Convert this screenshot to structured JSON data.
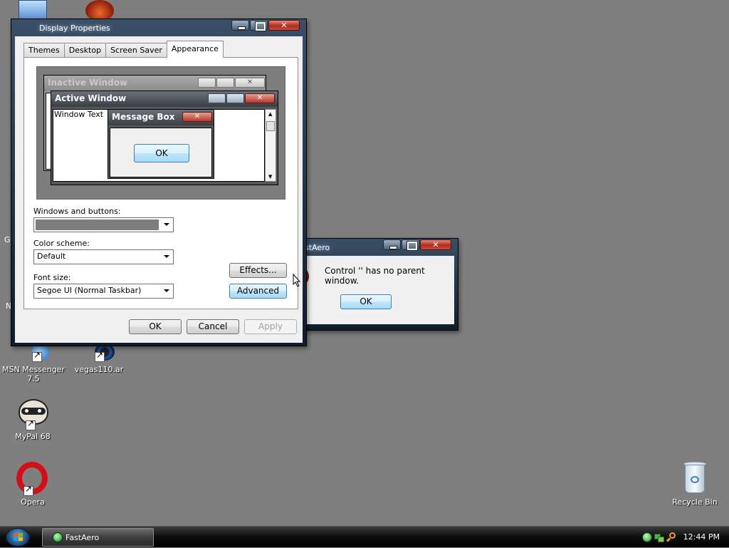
{
  "desktop": {
    "icons": [
      {
        "label": "MSN Messenger\n7.5",
        "icon": "msn-messenger-icon"
      },
      {
        "label": "vegas110.ar",
        "icon": "vegas-icon"
      },
      {
        "label": "MyPal 68",
        "icon": "mypal-raccoon-icon"
      },
      {
        "label": "Opera",
        "icon": "opera-icon"
      },
      {
        "label": "Recycle Bin",
        "icon": "recycle-bin-icon"
      }
    ],
    "edge_letters": [
      "G",
      "N"
    ]
  },
  "display_properties": {
    "title": "Display Properties",
    "tabs": [
      "Themes",
      "Desktop",
      "Screen Saver",
      "Appearance"
    ],
    "active_tab": "Appearance",
    "preview": {
      "inactive_title": "Inactive Window",
      "active_title": "Active Window",
      "window_text": "Window Text",
      "message_box_title": "Message Box",
      "ok_label": "OK"
    },
    "windows_and_buttons_label": "Windows and buttons:",
    "windows_and_buttons_value": "",
    "color_scheme_label": "Color scheme:",
    "color_scheme_value": "Default",
    "font_size_label": "Font size:",
    "font_size_value": "Segoe UI (Normal Taskbar)",
    "effects_label": "Effects...",
    "advanced_label": "Advanced",
    "ok_label": "OK",
    "cancel_label": "Cancel",
    "apply_label": "Apply"
  },
  "fastaero_dialog": {
    "title": "FastAero",
    "message": "Control '' has no parent window.",
    "ok_label": "OK"
  },
  "taskbar": {
    "task_label": "FastAero",
    "clock": "12:44 PM"
  },
  "colors": {
    "desktop": "#7f7f7f",
    "titlebar_dark": "#0f1c2b",
    "close_red": "#b02d1f",
    "focus_blue": "#3c7fb1"
  }
}
